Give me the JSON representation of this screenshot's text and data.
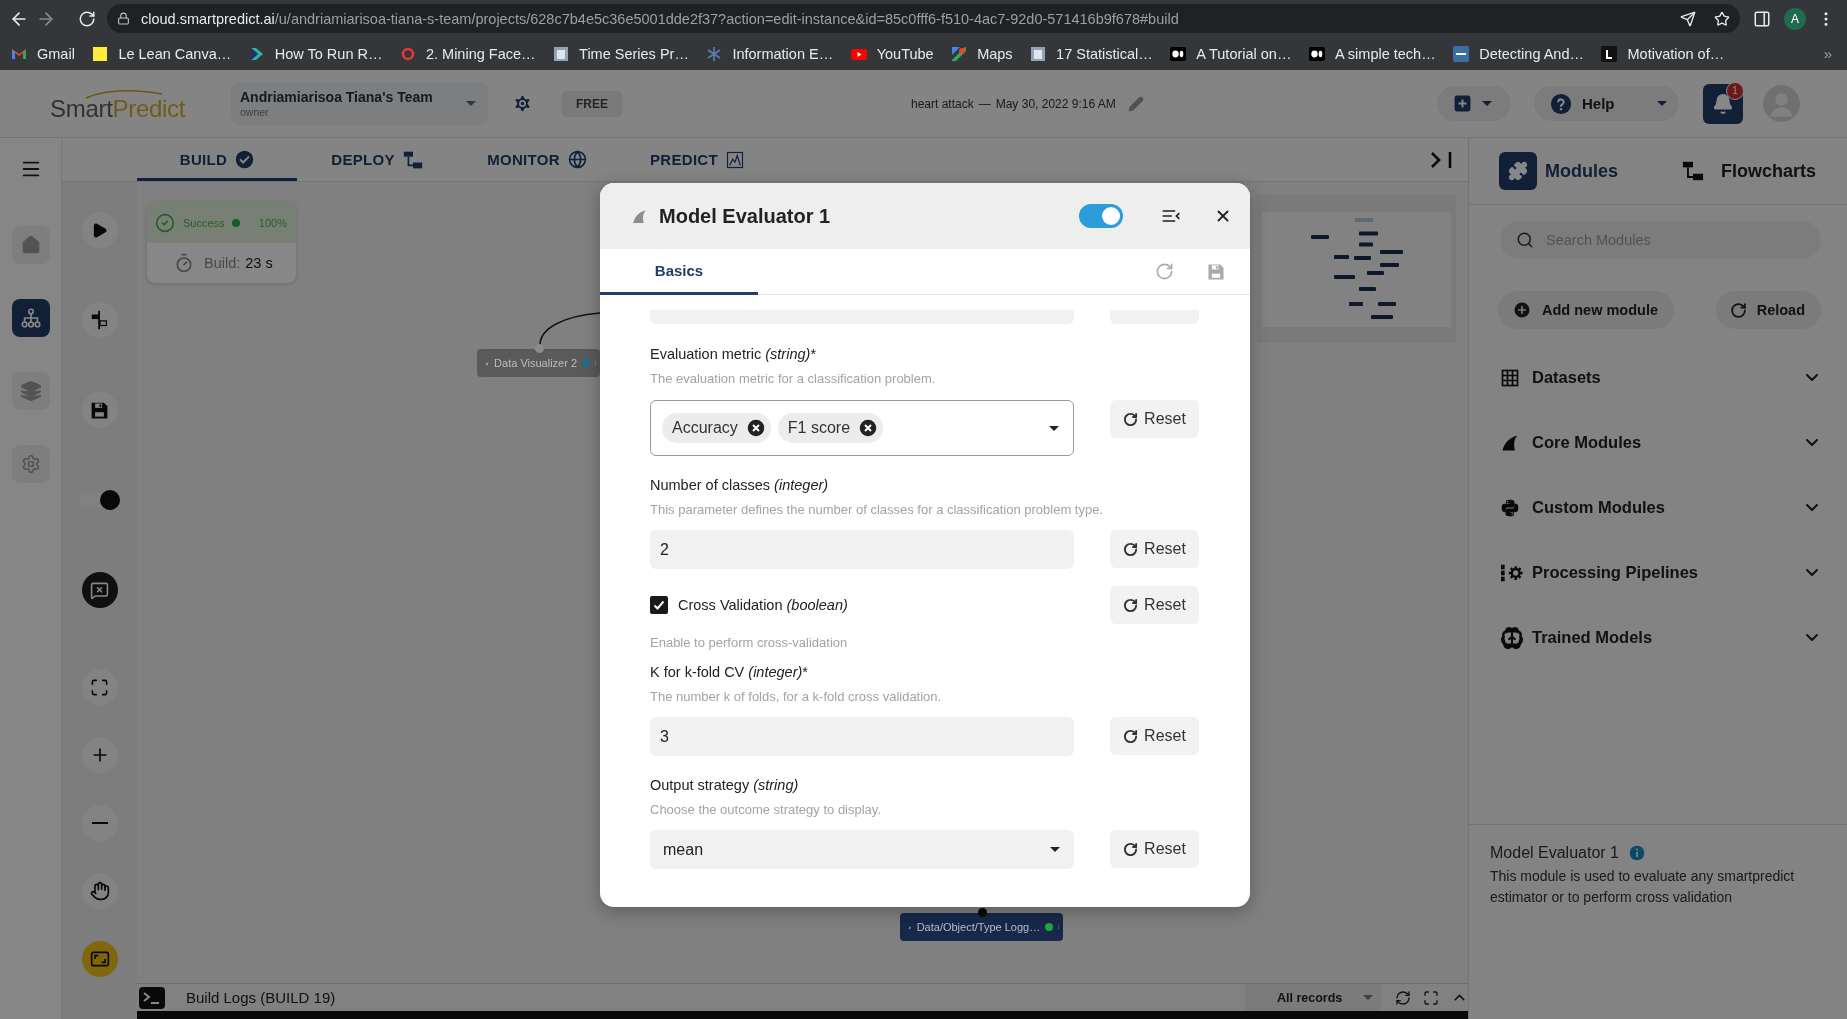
{
  "browser": {
    "url": {
      "host": "cloud.smartpredict.ai",
      "path": "/u/andriamiarisoa-tiana-s-team/projects/628c7b4e5c36e5001dde2f37?action=edit-instance&id=85c0fff6-f510-4ac7-92d0-571416b9f678#build"
    },
    "profile_initial": "A",
    "bookmarks": [
      "Gmail",
      "Le Lean Canva…",
      "How To Run R…",
      "2. Mining Face…",
      "Time Series Pr…",
      "Information E…",
      "YouTube",
      "Maps",
      "17 Statistical…",
      "A Tutorial on…",
      "A simple tech…",
      "Detecting And…",
      "Motivation of…"
    ],
    "more_bookmarks": "»"
  },
  "header": {
    "logo": {
      "first": "Smart",
      "second": "Predict"
    },
    "team": {
      "name": "Andriamiarisoa Tiana's Team",
      "role": "owner"
    },
    "plan": "FREE",
    "project": {
      "name": "heart attack",
      "separator": "—",
      "date": "May 30, 2022 9:16 AM"
    },
    "help": "Help",
    "notification_count": "1"
  },
  "nav_rail": [
    {
      "selected": false
    },
    {
      "selected": true
    },
    {
      "selected": false
    },
    {
      "selected": false
    }
  ],
  "workflow_tabs": [
    {
      "label": "BUILD",
      "selected": true
    },
    {
      "label": "DEPLOY",
      "selected": false
    },
    {
      "label": "MONITOR",
      "selected": false
    },
    {
      "label": "PREDICT",
      "selected": false
    }
  ],
  "canvas_tools": {
    "switch_on": true
  },
  "build_status": {
    "status": "Success",
    "progress": "100%",
    "label": "Build:",
    "duration": "23 s"
  },
  "nodes": [
    {
      "label": "Data Visualizer 2",
      "selected": false,
      "color": "#1b6f8e"
    },
    {
      "label": "Data/Object/Type Logg…",
      "selected": true,
      "color": "#1fa83a"
    }
  ],
  "modal": {
    "title": "Model Evaluator 1",
    "enabled": true,
    "tabs": [
      {
        "label": "Basics",
        "selected": true
      }
    ],
    "params": [
      {
        "kind": "multiselect",
        "label": "Evaluation metric *(string)*",
        "required_mark": "*",
        "description": "The evaluation metric for a classification problem.",
        "chips": [
          "Accuracy",
          "F1 score"
        ],
        "reset": "Reset"
      },
      {
        "kind": "text",
        "label": "Number of classes *(integer)*",
        "description": "This parameter defines the number of classes for a classification problem type.",
        "value": "2",
        "reset": "Reset"
      },
      {
        "kind": "checkbox",
        "label": "Cross Validation *(boolean)*",
        "checked": true,
        "description": "Enable to perform cross-validation",
        "reset": "Reset"
      },
      {
        "kind": "text",
        "label": "K for k-fold CV *(integer)*",
        "required_mark": "*",
        "description": "The number k of folds, for a k-fold cross validation.",
        "value": "3",
        "reset": "Reset"
      },
      {
        "kind": "select",
        "label": "Output strategy *(string)*",
        "description": "Choose the outcome strategy to display.",
        "value": "mean",
        "reset": "Reset"
      }
    ]
  },
  "side_panel": {
    "tabs": [
      {
        "label": "Modules",
        "selected": true
      },
      {
        "label": "Flowcharts",
        "selected": false
      }
    ],
    "search_placeholder": "Search Modules",
    "actions": [
      "Add new module",
      "Reload"
    ],
    "sections": [
      {
        "label": "Datasets",
        "expanded": false
      },
      {
        "label": "Core Modules",
        "expanded": false
      },
      {
        "label": "Custom Modules",
        "expanded": false
      },
      {
        "label": "Processing Pipelines",
        "expanded": false
      },
      {
        "label": "Trained Models",
        "expanded": false
      }
    ],
    "info": {
      "title": "Model Evaluator 1",
      "description": "This module is used to evaluate any smartpredict estimator or to perform cross validation"
    }
  },
  "build_logs": {
    "title": "Build Logs (BUILD 19)",
    "filter": "All records"
  }
}
